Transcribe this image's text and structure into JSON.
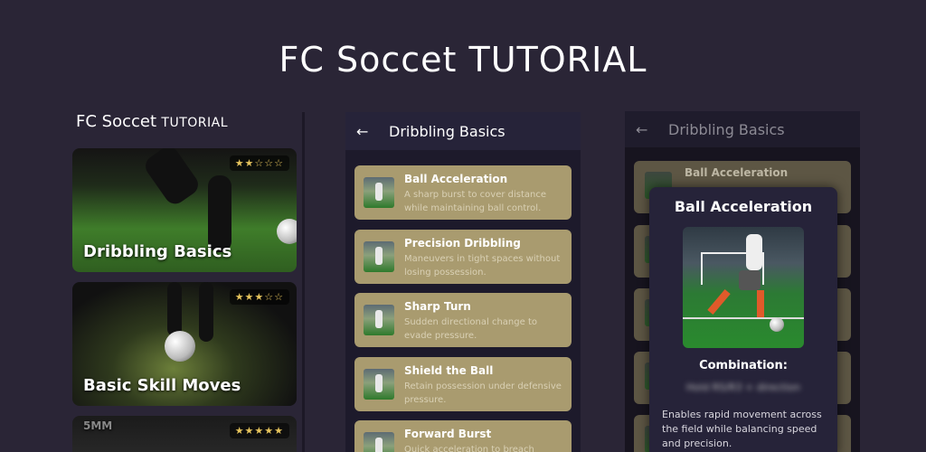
{
  "headline": "FC Soccet TUTORIAL",
  "home": {
    "app_title_brand": "FC Soccet",
    "app_title_sub": "TUTORIAL",
    "cards": [
      {
        "label": "Dribbling Basics",
        "rating_text": "★★☆☆☆",
        "rating": 2
      },
      {
        "label": "Basic Skill Moves",
        "rating_text": "★★★☆☆",
        "rating": 3
      },
      {
        "label": "5MM",
        "rating_text": "★★★★★",
        "rating": 5
      }
    ]
  },
  "list_screen": {
    "back_icon": "←",
    "title": "Dribbling Basics",
    "items": [
      {
        "title": "Ball Acceleration",
        "desc": "A sharp burst to cover distance while maintaining ball control."
      },
      {
        "title": "Precision Dribbling",
        "desc": "Maneuvers in tight spaces without losing possession."
      },
      {
        "title": "Sharp Turn",
        "desc": "Sudden directional change to evade pressure."
      },
      {
        "title": "Shield the Ball",
        "desc": "Retain possession under defensive pressure."
      },
      {
        "title": "Forward Burst",
        "desc": "Quick acceleration to breach"
      }
    ]
  },
  "detail_screen": {
    "back_icon": "←",
    "title": "Dribbling Basics",
    "background_item": "Ball Acceleration",
    "modal": {
      "title": "Ball Acceleration",
      "combination_label": "Combination:",
      "combination_value": "Hold RS/R3 + direction",
      "description": "Enables rapid movement across the field while balancing speed and precision."
    }
  },
  "colors": {
    "background": "#2a2536",
    "item_card": "#a99b6f",
    "panel": "#262339"
  }
}
